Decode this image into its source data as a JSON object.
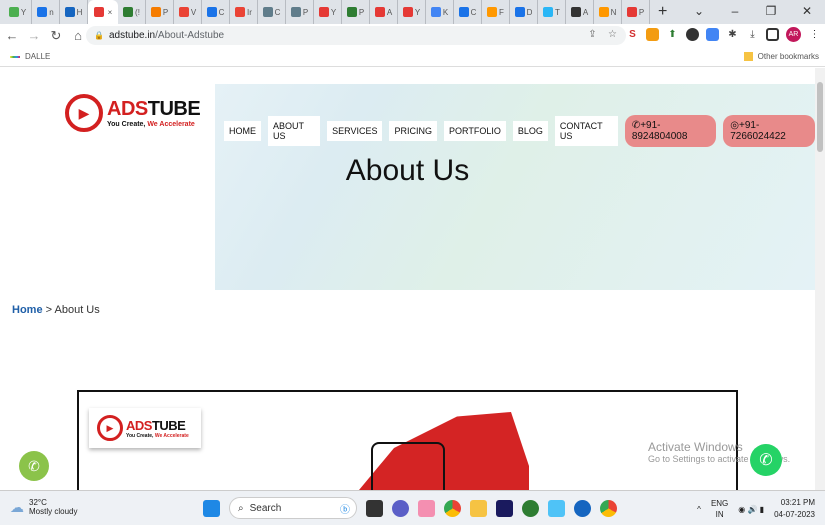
{
  "browser": {
    "tabs": [
      {
        "label": "Y",
        "color": "#4caf50"
      },
      {
        "label": "n",
        "color": "#1a73e8"
      },
      {
        "label": "H",
        "color": "#1565c0"
      },
      {
        "label": "",
        "color": "#e53935",
        "active": true
      },
      {
        "label": "(!",
        "color": "#2e7d32"
      },
      {
        "label": "P",
        "color": "#f57c00"
      },
      {
        "label": "V",
        "color": "#ea4335"
      },
      {
        "label": "C",
        "color": "#1a73e8"
      },
      {
        "label": "Ir",
        "color": "#ea4335"
      },
      {
        "label": "C",
        "color": "#607d8b"
      },
      {
        "label": "P",
        "color": "#607d8b"
      },
      {
        "label": "Y",
        "color": "#e53935"
      },
      {
        "label": "P",
        "color": "#2e7d32"
      },
      {
        "label": "A",
        "color": "#e53935"
      },
      {
        "label": "Y",
        "color": "#e53935"
      },
      {
        "label": "K",
        "color": "#4285f4"
      },
      {
        "label": "C",
        "color": "#1a73e8"
      },
      {
        "label": "F",
        "color": "#ff9800"
      },
      {
        "label": "D",
        "color": "#1a73e8"
      },
      {
        "label": "T",
        "color": "#29b6f6"
      },
      {
        "label": "A",
        "color": "#333333"
      },
      {
        "label": "N",
        "color": "#ff9800"
      },
      {
        "label": "P",
        "color": "#e53935"
      }
    ],
    "close_tab": "×",
    "new_tab": "+",
    "url_host": "adstube.in",
    "url_path": "/About-Adstube",
    "profile": "AR",
    "bookmark": "DALLE",
    "other_bookmarks": "Other bookmarks"
  },
  "site": {
    "brand_ads": "ADS",
    "brand_tube": "TUBE",
    "tagline_a": "You Create, ",
    "tagline_b": "We Accelerate",
    "menu": [
      "HOME",
      "ABOUT US",
      "SERVICES",
      "PRICING",
      "PORTFOLIO",
      "BLOG",
      "CONTACT US"
    ],
    "phone1": "+91-8924804008",
    "phone2": "+91-7266024422",
    "title": "About Us",
    "breadcrumb_home": "Home",
    "breadcrumb_sep": " > ",
    "breadcrumb_current": "About Us"
  },
  "watermark": {
    "title": "Activate Windows",
    "sub": "Go to Settings to activate Windows."
  },
  "taskbar": {
    "temp": "32°C",
    "weather": "Mostly cloudy",
    "search": "Search",
    "lang1": "ENG",
    "lang2": "IN",
    "time": "03:21 PM",
    "date": "04-07-2023",
    "badge": "AR"
  }
}
